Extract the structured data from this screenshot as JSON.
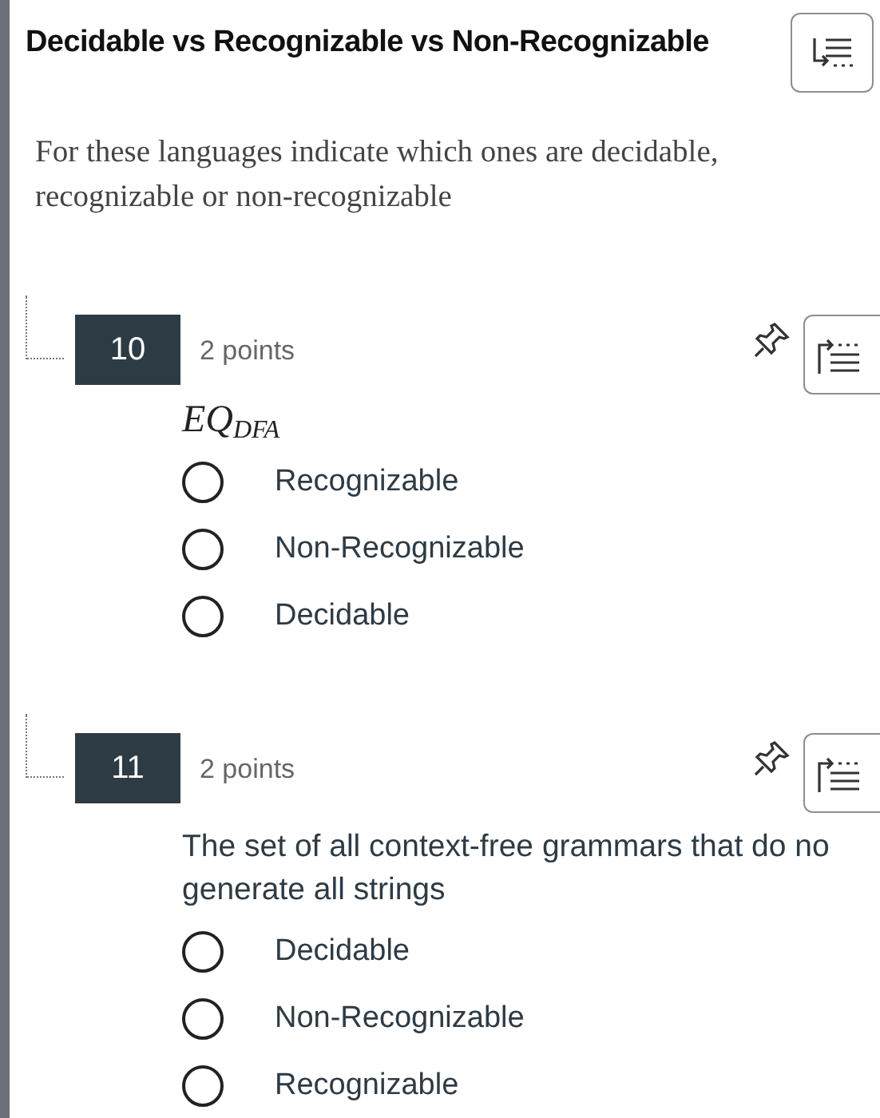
{
  "header": {
    "title": "Decidable vs Recognizable vs Non-Recognizable"
  },
  "description": "For these languages indicate which ones are decidable, recognizable or non-recognizable",
  "questions": [
    {
      "number": "10",
      "points": "2 points",
      "kind": "math",
      "prompt_lines": [
        "*EQ*$_{DFA}$"
      ],
      "options": [
        {
          "label": "Recognizable",
          "selected": false
        },
        {
          "label": "Non-Recognizable",
          "selected": false
        },
        {
          "label": "Decidable",
          "selected": false
        }
      ]
    },
    {
      "number": "11",
      "points": "2 points",
      "kind": "text",
      "prompt_lines": [
        "The set of all context-free grammars that do no",
        "generate all strings"
      ],
      "options": [
        {
          "label": "Decidable",
          "selected": false
        },
        {
          "label": "Non-Recognizable",
          "selected": false
        },
        {
          "label": "Recognizable",
          "selected": false
        }
      ]
    }
  ]
}
